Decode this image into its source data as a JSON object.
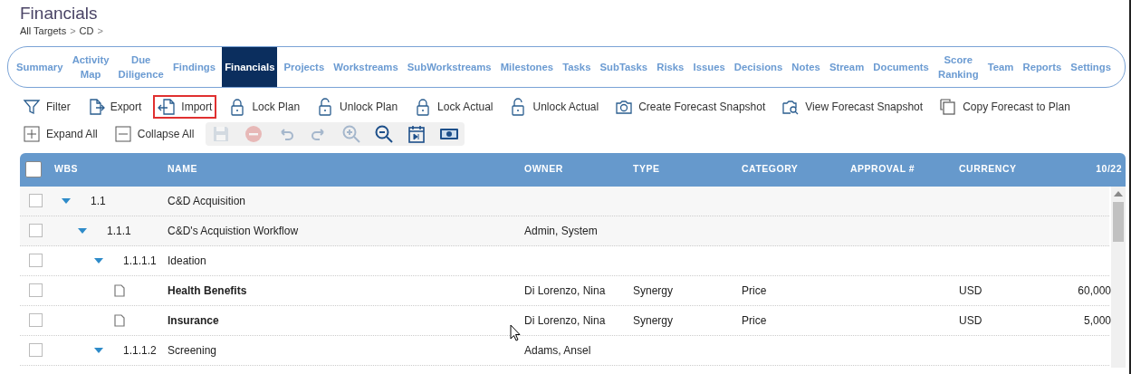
{
  "title": "Financials",
  "breadcrumb": [
    {
      "label": "All Targets",
      "separator": ">"
    },
    {
      "label": "CD",
      "separator": ">"
    }
  ],
  "tabs": [
    {
      "label": "Summary",
      "selected": false
    },
    {
      "label": "Activity Map",
      "selected": false
    },
    {
      "label": "Due Diligence",
      "selected": false
    },
    {
      "label": "Findings",
      "selected": false
    },
    {
      "label": "Financials",
      "selected": true
    },
    {
      "label": "Projects",
      "selected": false
    },
    {
      "label": "Workstreams",
      "selected": false
    },
    {
      "label": "SubWorkstreams",
      "selected": false
    },
    {
      "label": "Milestones",
      "selected": false
    },
    {
      "label": "Tasks",
      "selected": false
    },
    {
      "label": "SubTasks",
      "selected": false
    },
    {
      "label": "Risks",
      "selected": false
    },
    {
      "label": "Issues",
      "selected": false
    },
    {
      "label": "Decisions",
      "selected": false
    },
    {
      "label": "Notes",
      "selected": false
    },
    {
      "label": "Stream",
      "selected": false
    },
    {
      "label": "Documents",
      "selected": false
    },
    {
      "label": "Score Ranking",
      "selected": false
    },
    {
      "label": "Team",
      "selected": false
    },
    {
      "label": "Reports",
      "selected": false
    },
    {
      "label": "Settings",
      "selected": false
    }
  ],
  "actions": [
    {
      "label": "Filter",
      "highlighted": false
    },
    {
      "label": "Export",
      "highlighted": false
    },
    {
      "label": "Import",
      "highlighted": true
    },
    {
      "label": "Lock Plan",
      "highlighted": false
    },
    {
      "label": "Unlock Plan",
      "highlighted": false
    },
    {
      "label": "Lock Actual",
      "highlighted": false
    },
    {
      "label": "Unlock Actual",
      "highlighted": false
    },
    {
      "label": "Create Forecast Snapshot",
      "highlighted": false
    },
    {
      "label": "View Forecast Snapshot",
      "highlighted": false
    },
    {
      "label": "Copy Forecast to Plan",
      "highlighted": false
    }
  ],
  "tree_actions": [
    {
      "label": "Expand All"
    },
    {
      "label": "Collapse All"
    }
  ],
  "tools": [
    {
      "disabled": true
    },
    {
      "disabled": true
    },
    {
      "disabled": true
    },
    {
      "disabled": true
    },
    {
      "disabled": true
    },
    {
      "disabled": false
    },
    {
      "disabled": false
    },
    {
      "disabled": false
    }
  ],
  "table": {
    "select_all": {
      "checked": false
    },
    "columns": [
      "WBS",
      "NAME",
      "OWNER",
      "TYPE",
      "CATEGORY",
      "APPROVAL #",
      "CURRENCY",
      "10/22"
    ],
    "rows": [
      {
        "kind": "group",
        "checked": false,
        "expanded": true,
        "wbs": "1.1",
        "name": "C&D Acquisition",
        "children": [
          {
            "kind": "group",
            "checked": false,
            "expanded": true,
            "wbs": "1.1.1",
            "name": "C&D's Acquistion Workflow",
            "owner": "Admin, System",
            "children": [
              {
                "kind": "group",
                "checked": false,
                "expanded": true,
                "wbs": "1.1.1.1",
                "name": "Ideation",
                "children": [
                  {
                    "kind": "item",
                    "checked": false,
                    "name": "Health Benefits",
                    "owner": "Di Lorenzo, Nina",
                    "type": "Synergy",
                    "category": "Price",
                    "currency": "USD",
                    "value_10_22": "60,000"
                  },
                  {
                    "kind": "item",
                    "checked": false,
                    "name": "Insurance",
                    "owner": "Di Lorenzo, Nina",
                    "type": "Synergy",
                    "category": "Price",
                    "currency": "USD",
                    "value_10_22": "5,000"
                  }
                ]
              },
              {
                "kind": "group",
                "checked": false,
                "expanded": true,
                "wbs": "1.1.1.2",
                "name": "Screening",
                "owner": "Adams, Ansel"
              }
            ]
          }
        ]
      }
    ]
  }
}
